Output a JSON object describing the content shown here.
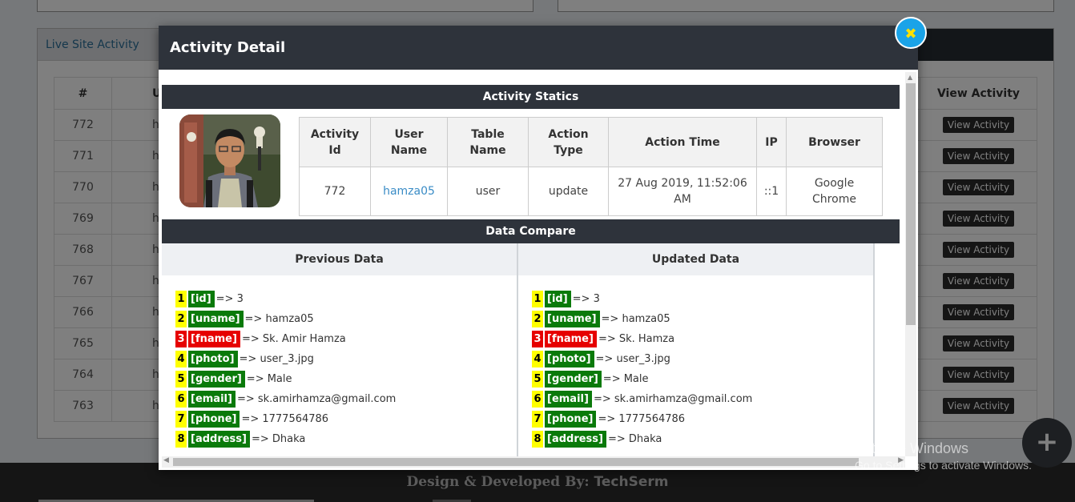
{
  "background": {
    "panel_title": "Live Site Activity",
    "table_headers": [
      "#",
      "Us",
      "View Activity"
    ],
    "rows": [
      {
        "id": "772",
        "user": "h",
        "action": "View Activity"
      },
      {
        "id": "771",
        "user": "h",
        "action": "View Activity"
      },
      {
        "id": "770",
        "user": "h",
        "action": "View Activity"
      },
      {
        "id": "769",
        "user": "h",
        "action": "View Activity"
      },
      {
        "id": "768",
        "user": "h",
        "action": "View Activity"
      },
      {
        "id": "767",
        "user": "h",
        "action": "View Activity"
      },
      {
        "id": "766",
        "user": "h",
        "action": "View Activity"
      },
      {
        "id": "765",
        "user": "h",
        "action": "View Activity"
      },
      {
        "id": "764",
        "user": "h",
        "action": "View Activity"
      },
      {
        "id": "763",
        "user": "h",
        "action": "View Activity"
      }
    ],
    "footer_prefix": "Design & Developed By: ",
    "footer_brand": "TechSerm",
    "fab_icon": "+"
  },
  "watermark": {
    "line1": "Activate Windows",
    "line2": "Go to Settings to activate Windows."
  },
  "modal": {
    "title": "Activity Detail",
    "close_icon": "✖",
    "statics_title": "Activity Statics",
    "info_headers": {
      "activity_id": "Activity Id",
      "user_name": "User Name",
      "table_name": "Table Name",
      "action_type": "Action Type",
      "action_time": "Action Time",
      "ip": "IP",
      "browser": "Browser"
    },
    "info_values": {
      "activity_id": "772",
      "user_name": "hamza05",
      "table_name": "user",
      "action_type": "update",
      "action_time": "27 Aug 2019, 11:52:06 AM",
      "ip": "::1",
      "browser": "Google Chrome"
    },
    "compare_title": "Data Compare",
    "previous_label": "Previous Data",
    "updated_label": "Updated Data",
    "previous": [
      {
        "n": "1",
        "key": "[id]",
        "val": "=> 3",
        "changed": false
      },
      {
        "n": "2",
        "key": "[uname]",
        "val": "=> hamza05",
        "changed": false
      },
      {
        "n": "3",
        "key": "[fname]",
        "val": "=> Sk. Amir Hamza",
        "changed": true
      },
      {
        "n": "4",
        "key": "[photo]",
        "val": "=> user_3.jpg",
        "changed": false
      },
      {
        "n": "5",
        "key": "[gender]",
        "val": "=> Male",
        "changed": false
      },
      {
        "n": "6",
        "key": "[email]",
        "val": "=> sk.amirhamza@gmail.com",
        "changed": false
      },
      {
        "n": "7",
        "key": "[phone]",
        "val": "=> 1777564786",
        "changed": false
      },
      {
        "n": "8",
        "key": "[address]",
        "val": "=> Dhaka",
        "changed": false
      }
    ],
    "updated": [
      {
        "n": "1",
        "key": "[id]",
        "val": "=> 3",
        "changed": false
      },
      {
        "n": "2",
        "key": "[uname]",
        "val": "=> hamza05",
        "changed": false
      },
      {
        "n": "3",
        "key": "[fname]",
        "val": "=> Sk. Hamza",
        "changed": true
      },
      {
        "n": "4",
        "key": "[photo]",
        "val": "=> user_3.jpg",
        "changed": false
      },
      {
        "n": "5",
        "key": "[gender]",
        "val": "=> Male",
        "changed": false
      },
      {
        "n": "6",
        "key": "[email]",
        "val": "=> sk.amirhamza@gmail.com",
        "changed": false
      },
      {
        "n": "7",
        "key": "[phone]",
        "val": "=> 1777564786",
        "changed": false
      },
      {
        "n": "8",
        "key": "[address]",
        "val": "=> Dhaka",
        "changed": false
      }
    ]
  },
  "colors": {
    "header_dark": "#2e333b",
    "close_button": "#1aa3e8",
    "key_green": "#0a7a0a",
    "changed_red": "#e60000",
    "index_yellow": "#ffff00",
    "link_blue": "#3a8cc6"
  }
}
